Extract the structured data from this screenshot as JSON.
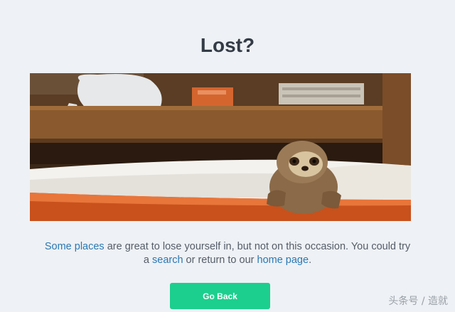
{
  "page": {
    "title": "Lost?",
    "message": {
      "link_some_places": "Some places",
      "text_1": " are great to lose yourself in, but not on this occasion. You could try a ",
      "link_search": "search",
      "text_2": " or return to our ",
      "link_home": "home page",
      "text_3": "."
    },
    "go_back_label": "Go Back"
  },
  "image": {
    "subject": "baby sloth peeking over the rim of an orange bathtub",
    "alt": ""
  },
  "watermark": "头条号 / 造就",
  "colors": {
    "background": "#eef1f5",
    "title": "#333b46",
    "link": "#2a78b3",
    "button": "#1ccf8e"
  }
}
